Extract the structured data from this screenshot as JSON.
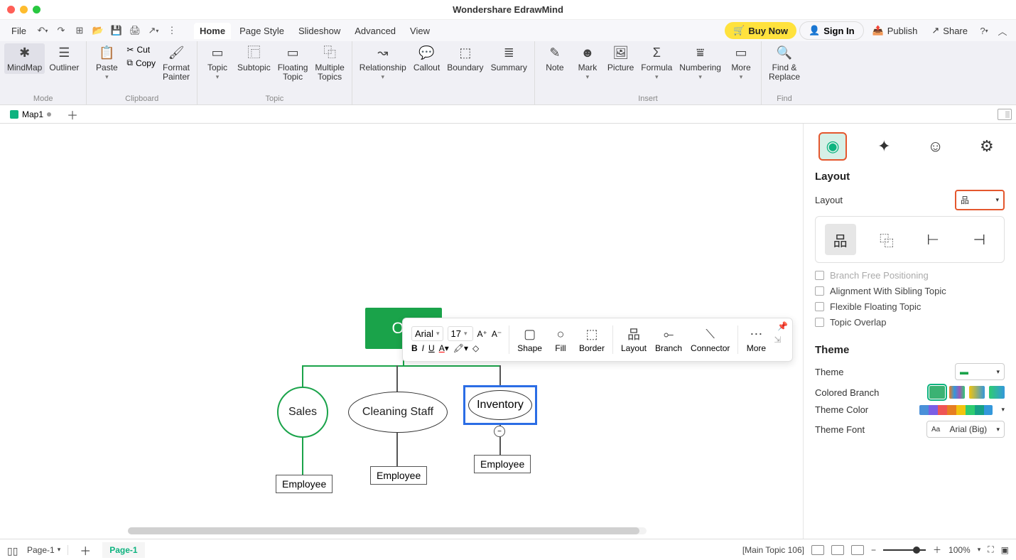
{
  "app_title": "Wondershare EdrawMind",
  "menu": {
    "file": "File",
    "tabs": [
      "Home",
      "Page Style",
      "Slideshow",
      "Advanced",
      "View"
    ],
    "active_tab": "Home",
    "buy_now": "Buy Now",
    "sign_in": "Sign In",
    "publish": "Publish",
    "share": "Share"
  },
  "ribbon": {
    "mode": {
      "label": "Mode",
      "mindmap": "MindMap",
      "outliner": "Outliner"
    },
    "clipboard": {
      "label": "Clipboard",
      "paste": "Paste",
      "cut": "Cut",
      "copy": "Copy",
      "format_painter": "Format\nPainter"
    },
    "topic": {
      "label": "Topic",
      "topic": "Topic",
      "subtopic": "Subtopic",
      "floating": "Floating\nTopic",
      "multiple": "Multiple\nTopics"
    },
    "relations": {
      "relationship": "Relationship",
      "callout": "Callout",
      "boundary": "Boundary",
      "summary": "Summary"
    },
    "insert": {
      "label": "Insert",
      "note": "Note",
      "mark": "Mark",
      "picture": "Picture",
      "formula": "Formula",
      "numbering": "Numbering",
      "more": "More"
    },
    "find": {
      "label": "Find",
      "find_replace": "Find &\nReplace"
    }
  },
  "doc_tab": "Map1",
  "chart": {
    "owner": "Ow",
    "sales": "Sales",
    "cleaning": "Cleaning Staff",
    "inventory": "Inventory",
    "employee": "Employee"
  },
  "float_toolbar": {
    "font": "Arial",
    "size": "17",
    "shape": "Shape",
    "fill": "Fill",
    "border": "Border",
    "layout": "Layout",
    "branch": "Branch",
    "connector": "Connector",
    "more": "More"
  },
  "sidepanel": {
    "layout_hdr": "Layout",
    "layout_label": "Layout",
    "branch_free": "Branch Free Positioning",
    "align_sibling": "Alignment With Sibling Topic",
    "flex_float": "Flexible Floating Topic",
    "topic_overlap": "Topic Overlap",
    "theme_hdr": "Theme",
    "theme_label": "Theme",
    "colored_branch": "Colored Branch",
    "theme_color": "Theme Color",
    "theme_font": "Theme Font",
    "theme_font_val": "Arial (Big)"
  },
  "status": {
    "page_sel": "Page-1",
    "page_tab": "Page-1",
    "selection": "[Main Topic 106]",
    "zoom": "100%"
  }
}
